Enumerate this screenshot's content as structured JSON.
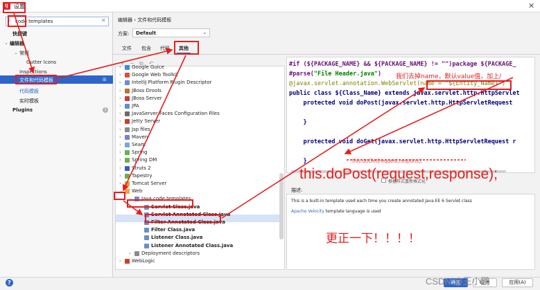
{
  "window": {
    "app_icon": "IJ",
    "title": "设置",
    "close_glyph": "✕"
  },
  "search": {
    "value": "code templates",
    "icon": "search-icon",
    "clear_glyph": "✕"
  },
  "sidebar": {
    "items": [
      {
        "label": "快捷键"
      },
      {
        "label": "编辑器"
      },
      {
        "label": "常规"
      },
      {
        "label": "Gutter Icons"
      },
      {
        "label": "Inspections"
      },
      {
        "label": "文件和代码模板"
      },
      {
        "label": "代码模板"
      },
      {
        "label": "实时模板"
      },
      {
        "label": "Plugins"
      }
    ],
    "plugins_badge": "1",
    "selected_badge": "⊞"
  },
  "breadcrumb": "编辑器 › 文件和代码模板",
  "scheme": {
    "label": "方案:",
    "value": "Default",
    "arrow": "⌄"
  },
  "tabs": [
    "文件",
    "包含",
    "代码",
    "其他"
  ],
  "toolbar": [
    "+",
    "−",
    "⧉",
    "↶"
  ],
  "tree": {
    "rows": [
      {
        "label": "Google Guice",
        "chev": "›"
      },
      {
        "label": "Google Web Toolkit",
        "chev": "›"
      },
      {
        "label": "IntelliJ Platform Plugin Descriptor",
        "chev": "›"
      },
      {
        "label": "JBoss Drools",
        "chev": "›"
      },
      {
        "label": "JBoss Server",
        "chev": "›"
      },
      {
        "label": "JPA",
        "chev": "›"
      },
      {
        "label": "JavaServer Faces Configuration Files",
        "chev": "›"
      },
      {
        "label": "Jetty Server",
        "chev": "›"
      },
      {
        "label": "Jsp files",
        "chev": "›"
      },
      {
        "label": "Maven",
        "chev": "›"
      },
      {
        "label": "Seam",
        "chev": "›"
      },
      {
        "label": "Spring",
        "chev": "›"
      },
      {
        "label": "Spring DM",
        "chev": "›"
      },
      {
        "label": "Struts 2",
        "chev": "›"
      },
      {
        "label": "Tapestry",
        "chev": "›"
      },
      {
        "label": "Tomcat Server",
        "chev": "›"
      },
      {
        "label": "Web",
        "chev": "⌄"
      },
      {
        "label": "Java code templates",
        "chev": "⌄"
      },
      {
        "label": "Servlet Class.java",
        "chev": ""
      },
      {
        "label": "Servlet Annotated Class.java",
        "chev": ""
      },
      {
        "label": "Filter Annotated Class.java",
        "chev": ""
      },
      {
        "label": "Filter Class.java",
        "chev": ""
      },
      {
        "label": "Listener Class.java",
        "chev": ""
      },
      {
        "label": "Listener Annotated Class.java",
        "chev": ""
      },
      {
        "label": "Deployment descriptors",
        "chev": "›"
      },
      {
        "label": "WebLogic",
        "chev": "›"
      }
    ]
  },
  "editor": {
    "lines": [
      {
        "parts": [
          {
            "t": "#if (${PACKAGE_NAME} && ${PACKAGE_NAME} != \"\")package ${PACKAGE_",
            "c": "dir"
          }
        ]
      },
      {
        "parts": [
          {
            "t": "#parse(",
            "c": "dir"
          },
          {
            "t": "\"File Header.java\"",
            "c": "str"
          },
          {
            "t": ")",
            "c": "dir"
          }
        ]
      },
      {
        "parts": [
          {
            "t": "@javax.servlet.annotation.WebServlet(name = \"${Entity_Name}\")",
            "c": "ann"
          }
        ]
      },
      {
        "parts": [
          {
            "t": "public class ${Class_Name} extends javax.servlet.http.HttpServlet",
            "c": "kw"
          }
        ]
      },
      {
        "parts": [
          {
            "t": "    protected void doPost(javax.servlet.http.HttpServletRequest",
            "c": "kw"
          }
        ]
      },
      {
        "parts": [
          {
            "t": "",
            "c": "kw"
          }
        ]
      },
      {
        "parts": [
          {
            "t": "    }",
            "c": "kw"
          }
        ]
      },
      {
        "parts": [
          {
            "t": "",
            "c": "kw"
          }
        ]
      },
      {
        "parts": [
          {
            "t": "    protected void doGet(javax.servlet.http.HttpServletRequest r",
            "c": "kw"
          }
        ]
      },
      {
        "parts": [
          {
            "t": "",
            "c": "kw"
          }
        ]
      },
      {
        "parts": [
          {
            "t": "    }",
            "c": "kw"
          }
        ]
      }
    ]
  },
  "reformat": {
    "checkbox_label": "根据样式重新格式化"
  },
  "description": {
    "label": "描述:",
    "line1": "This is a built-in template used each time you create annotated Java EE 6 Servlet class",
    "link": "Apache Velocity",
    "line2_rest": " template language is used"
  },
  "footer": {
    "help": "?",
    "ok": "确定",
    "cancel": "取消",
    "apply": "应用(A)"
  },
  "annotations": {
    "name_note": "我们去掉name，默认value值，加上/",
    "code_note": "this.doPost(request,response);",
    "small_note": "this.doGet(request,respons);",
    "fix_note": "更正一下！！！！",
    "watermark": "CSDN @王小鹏"
  },
  "colors": {
    "accent": "#2f65ca",
    "annotation": "#e81c1c",
    "selection": "#d5e2f7"
  }
}
